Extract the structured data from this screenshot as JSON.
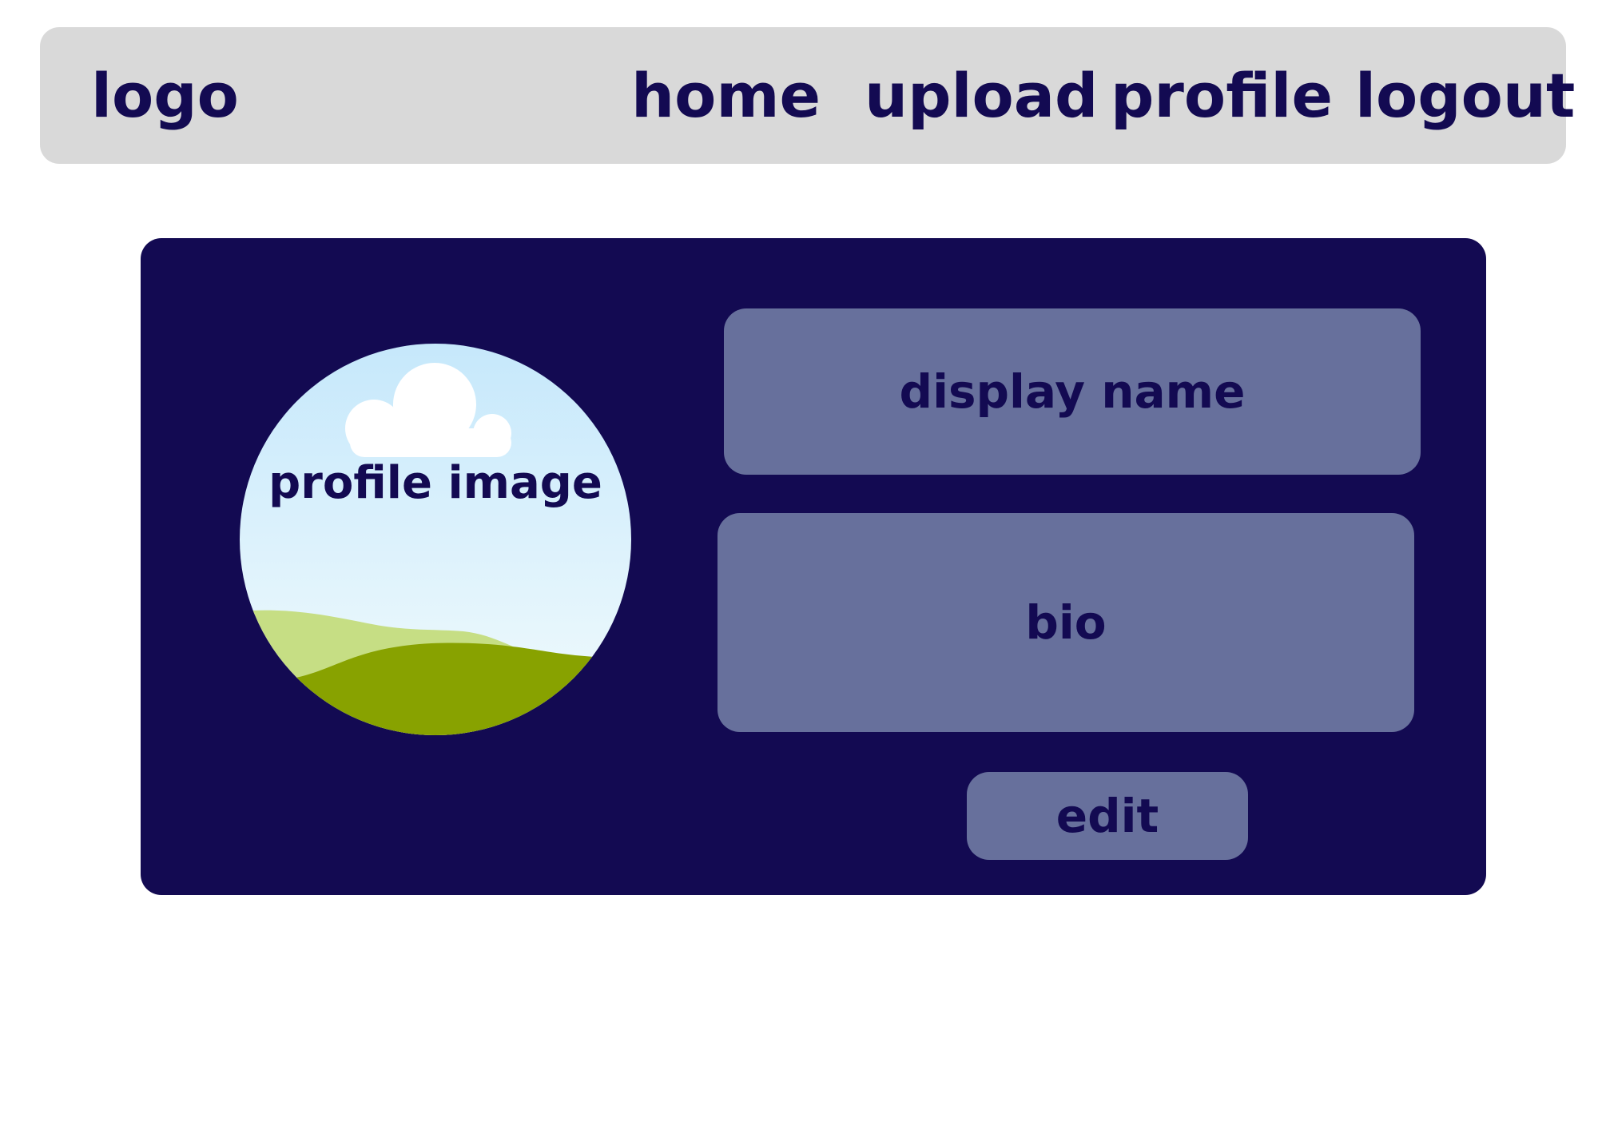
{
  "navbar": {
    "logo": "logo",
    "links": [
      "home",
      "upload",
      "profile",
      "logout"
    ]
  },
  "profile": {
    "image_label": "profile image",
    "display_name_label": "display name",
    "bio_label": "bio",
    "edit_label": "edit"
  },
  "colors": {
    "navbar_bg": "#d9d9d9",
    "card_bg": "#130a52",
    "field_bg": "#67709c",
    "text": "#130a52"
  }
}
